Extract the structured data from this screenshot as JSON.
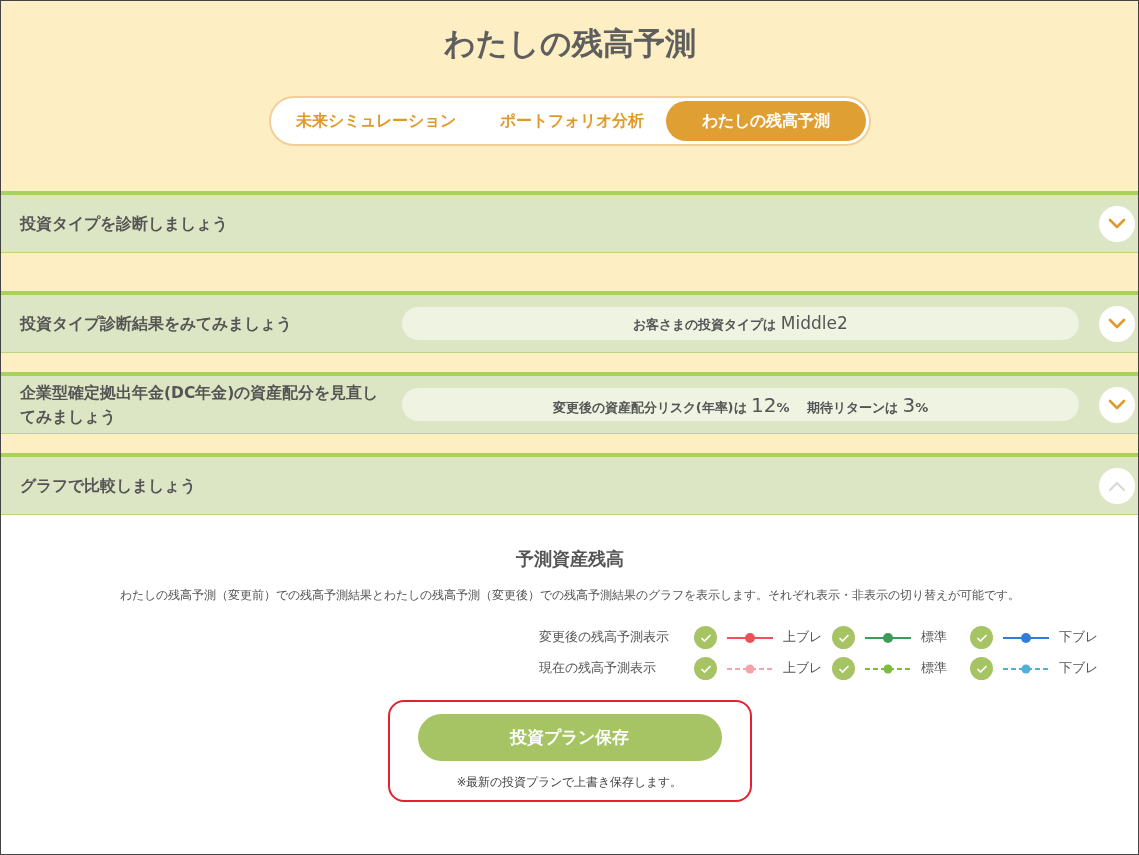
{
  "page": {
    "title": "わたしの残高予測"
  },
  "tabs": [
    {
      "label": "未来シミュレーション",
      "selected": false
    },
    {
      "label": "ポートフォリオ分析",
      "selected": false
    },
    {
      "label": "わたしの残高予測",
      "selected": true
    }
  ],
  "sections": [
    {
      "title": "投資タイプを診断しましょう",
      "expanded": false
    },
    {
      "title": "投資タイプ診断結果をみてみましょう",
      "expanded": false,
      "summary": [
        {
          "text": "お客さまの投資タイプは ",
          "kind": "label"
        },
        {
          "text": "Middle2",
          "kind": "value"
        }
      ]
    },
    {
      "title": "企業型確定拠出年金(DC年金)の資産配分を見直してみましょう",
      "expanded": false,
      "summary": [
        {
          "text": "変更後の資産配分リスク(年率)は ",
          "kind": "label"
        },
        {
          "text": "12",
          "kind": "number"
        },
        {
          "text": "%　 期待リターンは ",
          "kind": "label"
        },
        {
          "text": "3",
          "kind": "number"
        },
        {
          "text": "%",
          "kind": "label"
        }
      ]
    },
    {
      "title": "グラフで比較しましょう",
      "expanded": true
    }
  ],
  "chart_panel": {
    "title": "予測資産残高",
    "description": "わたしの残高予測（変更前）での残高予測結果とわたしの残高予測（変更後）での残高予測結果のグラフを表示します。それぞれ表示・非表示の切り替えが可能です。",
    "legend_rows": [
      {
        "label": "変更後の残高予測表示",
        "kind": "solid",
        "items": [
          {
            "checked": true,
            "color": "#f0505a",
            "label": "上ブレ"
          },
          {
            "checked": true,
            "color": "#3c9a5a",
            "label": "標準"
          },
          {
            "checked": true,
            "color": "#2f7fd8",
            "label": "下ブレ"
          }
        ]
      },
      {
        "label": "現在の残高予測表示",
        "kind": "dashed",
        "items": [
          {
            "checked": true,
            "color": "#f7a3a8",
            "label": "上ブレ"
          },
          {
            "checked": true,
            "color": "#7cbd3c",
            "label": "標準"
          },
          {
            "checked": true,
            "color": "#4fb0d8",
            "label": "下ブレ"
          }
        ]
      }
    ]
  },
  "save": {
    "button": "投資プラン保存",
    "note": "※最新の投資プランで上書き保存します。",
    "highlighted": true
  }
}
